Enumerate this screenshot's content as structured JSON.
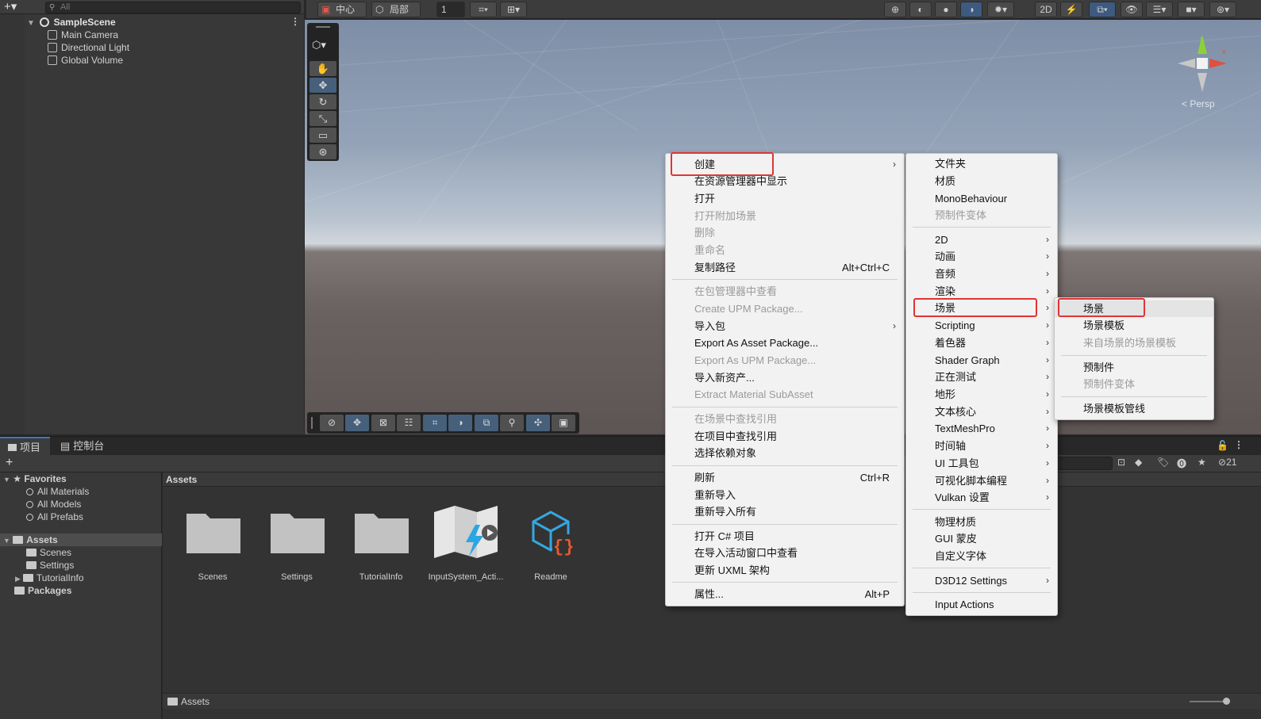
{
  "hierarchy": {
    "search_placeholder": "All",
    "scene": "SampleScene",
    "objects": [
      "Main Camera",
      "Directional Light",
      "Global Volume"
    ]
  },
  "scene_toolbar": {
    "pivot": "中心",
    "space": "局部",
    "grid_value": "1"
  },
  "scene_view": {
    "projection": "< Persp"
  },
  "bottom_tabs": [
    "项目",
    "控制台"
  ],
  "project": {
    "favorites": "Favorites",
    "fav_items": [
      "All Materials",
      "All Models",
      "All Prefabs"
    ],
    "assets": "Assets",
    "asset_folders": [
      "Scenes",
      "Settings",
      "TutorialInfo"
    ],
    "packages": "Packages",
    "breadcrumb": "Assets",
    "status_path": "Assets",
    "items": [
      "Scenes",
      "Settings",
      "TutorialInfo",
      "InputSystem_Acti...",
      "Readme"
    ],
    "hidden_count": "21"
  },
  "context_menu": {
    "items": [
      {
        "label": "创建",
        "arrow": true
      },
      {
        "label": "在资源管理器中显示"
      },
      {
        "label": "打开"
      },
      {
        "label": "打开附加场景",
        "disabled": true
      },
      {
        "label": "删除",
        "disabled": true
      },
      {
        "label": "重命名",
        "disabled": true
      },
      {
        "label": "复制路径",
        "shortcut": "Alt+Ctrl+C"
      },
      {
        "label": "在包管理器中查看",
        "disabled": true
      },
      {
        "label": "Create UPM Package...",
        "disabled": true
      },
      {
        "label": "导入包",
        "arrow": true
      },
      {
        "label": "Export As Asset Package..."
      },
      {
        "label": "Export As UPM Package...",
        "disabled": true
      },
      {
        "label": "导入新资产..."
      },
      {
        "label": "Extract Material SubAsset",
        "disabled": true
      },
      {
        "label": "在场景中查找引用",
        "disabled": true
      },
      {
        "label": "在项目中查找引用"
      },
      {
        "label": "选择依赖对象"
      },
      {
        "label": "刷新",
        "shortcut": "Ctrl+R"
      },
      {
        "label": "重新导入"
      },
      {
        "label": "重新导入所有"
      },
      {
        "label": "打开 C# 项目"
      },
      {
        "label": "在导入活动窗口中查看"
      },
      {
        "label": "更新 UXML 架构"
      },
      {
        "label": "属性...",
        "shortcut": "Alt+P"
      }
    ]
  },
  "create_menu": {
    "items": [
      {
        "label": "文件夹"
      },
      {
        "label": "材质"
      },
      {
        "label": "MonoBehaviour"
      },
      {
        "label": "预制件变体",
        "disabled": true
      },
      {
        "label": "2D",
        "arrow": true
      },
      {
        "label": "动画",
        "arrow": true
      },
      {
        "label": "音频",
        "arrow": true
      },
      {
        "label": "渲染",
        "arrow": true
      },
      {
        "label": "场景",
        "arrow": true
      },
      {
        "label": "Scripting",
        "arrow": true
      },
      {
        "label": "着色器",
        "arrow": true
      },
      {
        "label": "Shader Graph",
        "arrow": true
      },
      {
        "label": "正在测试",
        "arrow": true
      },
      {
        "label": "地形",
        "arrow": true
      },
      {
        "label": "文本核心",
        "arrow": true
      },
      {
        "label": "TextMeshPro",
        "arrow": true
      },
      {
        "label": "时间轴",
        "arrow": true
      },
      {
        "label": "UI 工具包",
        "arrow": true
      },
      {
        "label": "可视化脚本编程",
        "arrow": true
      },
      {
        "label": "Vulkan 设置",
        "arrow": true
      },
      {
        "label": "物理材质"
      },
      {
        "label": "GUI 蒙皮"
      },
      {
        "label": "自定义字体"
      },
      {
        "label": "D3D12 Settings",
        "arrow": true
      },
      {
        "label": "Input Actions"
      }
    ]
  },
  "scene_menu": {
    "items": [
      {
        "label": "场景"
      },
      {
        "label": "场景模板"
      },
      {
        "label": "来自场景的场景模板",
        "disabled": true
      },
      {
        "label": "预制件"
      },
      {
        "label": "预制件变体",
        "disabled": true
      },
      {
        "label": "场景模板管线"
      }
    ]
  },
  "colors": {
    "highlight_box": "#e03535",
    "accent": "#3a79bb"
  }
}
